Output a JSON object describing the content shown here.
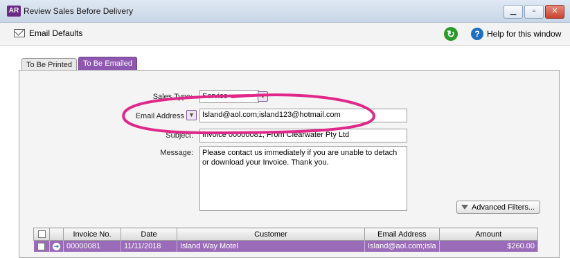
{
  "window": {
    "logo": "AR",
    "title": "Review Sales Before Delivery",
    "controls": [
      "minimize",
      "restore",
      "close"
    ]
  },
  "toolbar": {
    "email_defaults": "Email Defaults",
    "help": "Help for this window"
  },
  "tabs": [
    {
      "label": "To Be Printed"
    },
    {
      "label": "To Be Emailed"
    }
  ],
  "form": {
    "sales_type_label": "Sales Type:",
    "sales_type_value": "Service",
    "email_label": "Email Address",
    "email_value": "Island@aol.com;island123@hotmail.com",
    "subject_label": "Subject:",
    "subject_value": "Invoice 00000081; From Clearwater Pty Ltd",
    "message_label": "Message:",
    "message_value": "Please contact us immediately if you are unable to detach or download your Invoice. Thank you."
  },
  "advanced_filters": "Advanced Filters...",
  "grid": {
    "headers": [
      "",
      "Invoice No.",
      "Date",
      "Customer",
      "Email Address",
      "Amount"
    ],
    "rows": [
      {
        "invoice": "00000081",
        "date": "11/11/2018",
        "customer": "Island Way Motel",
        "email": "Island@aol.com;isla",
        "amount": "$260.00"
      }
    ]
  },
  "colors": {
    "accent": "#8e58b0",
    "highlight": "#e0288a"
  }
}
